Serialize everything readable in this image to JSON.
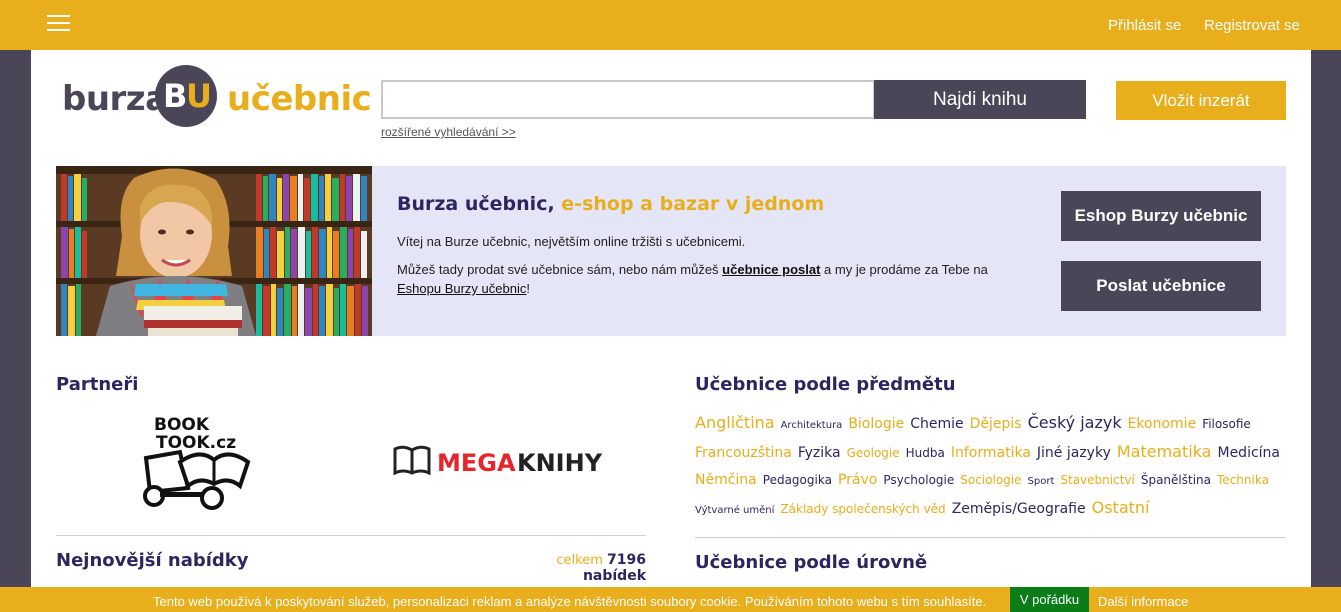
{
  "topbar": {
    "login": "Přihlásit se",
    "register": "Registrovat se"
  },
  "logo": {
    "word1": "burza",
    "b": "B",
    "u": "U",
    "word2": "učebnic"
  },
  "search": {
    "value": "",
    "button": "Najdi knihu",
    "advanced": "rozšířené vyhledávání >>"
  },
  "insert_button": "Vložit inzerát",
  "hero": {
    "title_main": "Burza učebnic,",
    "title_accent": "e-shop a bazar v jednom",
    "p1": "Vítej na Burze učebnic, největším online tržišti s učebnicemi.",
    "p2_a": "Můžeš tady prodat své učebnice sám, nebo nám můžeš ",
    "p2_link1": "učebnice poslat",
    "p2_b": " a my je prodáme za Tebe na ",
    "p2_link2": "Eshopu Burzy učebnic",
    "p2_c": "!",
    "btn_eshop": "Eshop Burzy učebnic",
    "btn_send": "Poslat učebnice"
  },
  "partners": {
    "title": "Partneři",
    "booktook": {
      "line1": "BOOK",
      "line2": "TOOK.cz"
    },
    "megaknihy": {
      "a": "MEGA",
      "b": "KNIHY"
    }
  },
  "subjects": {
    "title": "Učebnice podle předmětu",
    "items": [
      {
        "label": "Angličtina",
        "size": 16,
        "color": "#e8ae1b"
      },
      {
        "label": "Architektura",
        "size": 10,
        "color": "#2e2560"
      },
      {
        "label": "Biologie",
        "size": 14,
        "color": "#e8ae1b"
      },
      {
        "label": "Chemie",
        "size": 14,
        "color": "#2e2560"
      },
      {
        "label": "Dějepis",
        "size": 14,
        "color": "#e8ae1b"
      },
      {
        "label": "Český jazyk",
        "size": 16,
        "color": "#2e2560"
      },
      {
        "label": "Ekonomie",
        "size": 14,
        "color": "#e8ae1b"
      },
      {
        "label": "Filosofie",
        "size": 12,
        "color": "#2e2560"
      },
      {
        "label": "Francouzština",
        "size": 14,
        "color": "#e8ae1b"
      },
      {
        "label": "Fyzika",
        "size": 14,
        "color": "#2e2560"
      },
      {
        "label": "Geologie",
        "size": 12,
        "color": "#e8ae1b"
      },
      {
        "label": "Hudba",
        "size": 12,
        "color": "#2e2560"
      },
      {
        "label": "Informatika",
        "size": 14,
        "color": "#e8ae1b"
      },
      {
        "label": "Jiné jazyky",
        "size": 14,
        "color": "#2e2560"
      },
      {
        "label": "Matematika",
        "size": 16,
        "color": "#e8ae1b"
      },
      {
        "label": "Medicína",
        "size": 14,
        "color": "#2e2560"
      },
      {
        "label": "Němčina",
        "size": 14,
        "color": "#e8ae1b"
      },
      {
        "label": "Pedagogika",
        "size": 12,
        "color": "#2e2560"
      },
      {
        "label": "Právo",
        "size": 14,
        "color": "#e8ae1b"
      },
      {
        "label": "Psychologie",
        "size": 12,
        "color": "#2e2560"
      },
      {
        "label": "Sociologie",
        "size": 12,
        "color": "#e8ae1b"
      },
      {
        "label": "Sport",
        "size": 10,
        "color": "#2e2560"
      },
      {
        "label": "Stavebnictví",
        "size": 12,
        "color": "#e8ae1b"
      },
      {
        "label": "Španělština",
        "size": 12,
        "color": "#2e2560"
      },
      {
        "label": "Technika",
        "size": 12,
        "color": "#e8ae1b"
      },
      {
        "label": "Výtvarné umění",
        "size": 10,
        "color": "#2e2560"
      },
      {
        "label": "Základy společenských věd",
        "size": 12,
        "color": "#e8ae1b"
      },
      {
        "label": "Zeměpis/Geografie",
        "size": 14,
        "color": "#2e2560"
      },
      {
        "label": "Ostatní",
        "size": 16,
        "color": "#e8ae1b"
      }
    ]
  },
  "newest": {
    "title": "Nejnovější nabídky",
    "count_prefix": "celkem",
    "count_value": "7196 nabídek"
  },
  "levels": {
    "title": "Učebnice podle úrovně"
  },
  "cookie": {
    "text": "Tento web používá k poskytování služeb, personalizaci reklam a analýze návštěvnosti soubory cookie. Používáním tohoto webu s tím souhlasíte.",
    "ok": "V pořádku",
    "more": "Další informace"
  }
}
